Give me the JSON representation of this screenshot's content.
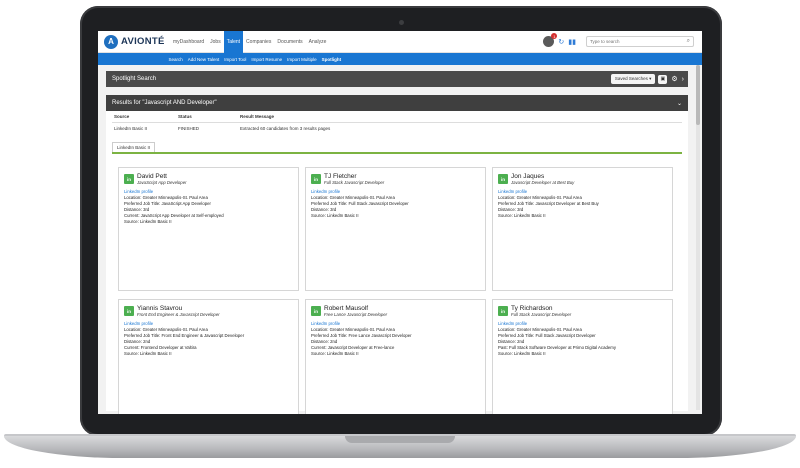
{
  "app": {
    "logo_mark": "A",
    "logo_text": "AVIONTÉ"
  },
  "nav": [
    {
      "label": "myDashboard",
      "active": false
    },
    {
      "label": "Jobs",
      "active": false
    },
    {
      "label": "Talent",
      "active": true
    },
    {
      "label": "Companies",
      "active": false
    },
    {
      "label": "Documents",
      "active": false
    },
    {
      "label": "Analyze",
      "active": false
    }
  ],
  "notifications": {
    "count": "1"
  },
  "search": {
    "placeholder": "Type to search"
  },
  "subnav": [
    {
      "label": "Search",
      "active": false
    },
    {
      "label": "Add New Talent",
      "active": false
    },
    {
      "label": "Import Tool",
      "active": false
    },
    {
      "label": "Import Resume",
      "active": false
    },
    {
      "label": "Import Multiple",
      "active": false
    },
    {
      "label": "Spotlight",
      "active": true
    }
  ],
  "spotlight": {
    "title": "Spotlight Search",
    "saved_searches_label": "Saved Searches ▾"
  },
  "results": {
    "title": "Results for \"Javascript AND Developer\"",
    "columns": [
      "Source",
      "Status",
      "Result Message"
    ],
    "rows": [
      {
        "source": "LinkedIn Basic II",
        "status": "FINISHED",
        "message": "Extracted 60 candidates from 3 results pages"
      }
    ],
    "tab_label": "LinkedIn Basic II"
  },
  "cards": [
    {
      "name": "David Pett",
      "title": "JavaScript App Developer",
      "link": "LinkedIn profile",
      "lines": [
        "Location: Greater Minneapolis-St. Paul Area",
        "Preferred Job Title: JavaScript App Developer",
        "Distance: 3rd",
        "Current: JavaScript App Developer at Self-employed",
        "Source: LinkedIn Basic II"
      ]
    },
    {
      "name": "TJ Fletcher",
      "title": "Full Stack Javascript Developer",
      "link": "LinkedIn profile",
      "lines": [
        "Location: Greater Minneapolis-St. Paul Area",
        "Preferred Job Title: Full Stack Javascript Developer",
        "Distance: 3rd",
        "Source: LinkedIn Basic II"
      ]
    },
    {
      "name": "Jon Jaques",
      "title": "Javascript Developer at Best Buy",
      "link": "LinkedIn profile",
      "lines": [
        "Location: Greater Minneapolis-St. Paul Area",
        "Preferred Job Title: Javascript Developer at Best Buy",
        "Distance: 3rd",
        "Source: LinkedIn Basic II"
      ]
    },
    {
      "name": "Yiannis Stavrou",
      "title": "Front End Engineer & Javascript Developer",
      "link": "LinkedIn profile",
      "lines": [
        "Location: Greater Minneapolis-St. Paul Area",
        "Preferred Job Title: Front End Engineer & Javascript Developer",
        "Distance: 2nd",
        "Current: Frontend Developer at Valtira",
        "Source: LinkedIn Basic II"
      ]
    },
    {
      "name": "Robert Mausolf",
      "title": "Free Lance Javascript Developer",
      "link": "LinkedIn profile",
      "lines": [
        "Location: Greater Minneapolis-St. Paul Area",
        "Preferred Job Title: Free Lance Javascript Developer",
        "Distance: 2nd",
        "Current: Javascript Developer at Free-lance",
        "Source: LinkedIn Basic II"
      ]
    },
    {
      "name": "Ty Richardson",
      "title": "Full Stack Javascript Developer",
      "link": "LinkedIn profile",
      "lines": [
        "Location: Greater Minneapolis-St. Paul Area",
        "Preferred Job Title: Full Stack Javascript Developer",
        "Distance: 2nd",
        "Past: Full Stack Software Developer at Primo Digital Academy",
        "Source: LinkedIn Basic II"
      ]
    }
  ],
  "colors": {
    "accent": "#1976d2",
    "header_dark": "#4a4a4a",
    "linkedin_green": "#4caf50",
    "divider_green": "#7cb342"
  },
  "icons": {
    "card": "linkedin-icon",
    "settings": "gear-icon",
    "search": "search-icon"
  }
}
